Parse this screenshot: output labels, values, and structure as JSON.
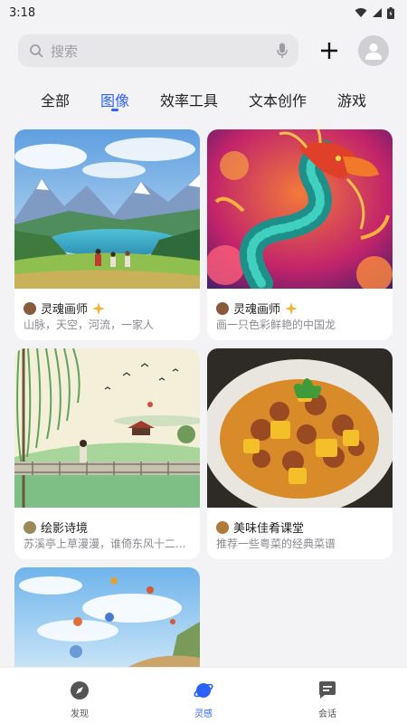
{
  "status": {
    "time": "3:18"
  },
  "search": {
    "placeholder": "搜索"
  },
  "tabs": [
    {
      "label": "全部",
      "active": false
    },
    {
      "label": "图像",
      "active": true
    },
    {
      "label": "效率工具",
      "active": false
    },
    {
      "label": "文本创作",
      "active": false
    },
    {
      "label": "游戏",
      "active": false
    }
  ],
  "cards": [
    {
      "author": "灵魂画师",
      "badge": true,
      "desc": "山脉，天空，河流，一家人"
    },
    {
      "author": "灵魂画师",
      "badge": true,
      "desc": "画一只色彩鲜艳的中国龙"
    },
    {
      "author": "绘影诗境",
      "badge": false,
      "desc": "苏溪亭上草漫漫，谁倚东风十二..."
    },
    {
      "author": "美味佳肴课堂",
      "badge": false,
      "desc": "推荐一些粤菜的经典菜谱"
    }
  ],
  "nav": [
    {
      "label": "发现",
      "icon": "compass-icon",
      "active": false
    },
    {
      "label": "灵感",
      "icon": "planet-icon",
      "active": true
    },
    {
      "label": "会话",
      "icon": "chat-icon",
      "active": false
    }
  ],
  "colors": {
    "accent": "#2c62f6",
    "background": "#f3f3f5"
  }
}
